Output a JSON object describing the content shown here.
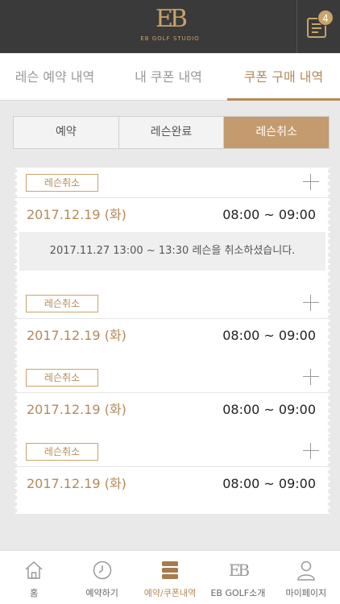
{
  "header": {
    "logo_mark": "EB",
    "logo_text": "EB GOLF STUDIO",
    "notice_count": "4"
  },
  "tabs": [
    {
      "label": "레슨 예약 내역",
      "active": false
    },
    {
      "label": "내 쿠폰 내역",
      "active": false
    },
    {
      "label": "쿠폰 구매 내역",
      "active": true
    }
  ],
  "segment": [
    {
      "label": "예약",
      "active": false
    },
    {
      "label": "레슨완료",
      "active": false
    },
    {
      "label": "레슨취소",
      "active": true
    }
  ],
  "cards": [
    {
      "badge": "레슨취소",
      "date": "2017.12.19 (화)",
      "time": "08:00 ~ 09:00",
      "note": "2017.11.27 13:00 ~ 13:30 레슨을 취소하셨습니다."
    },
    {
      "badge": "레슨취소",
      "date": "2017.12.19 (화)",
      "time": "08:00 ~ 09:00"
    },
    {
      "badge": "레슨취소",
      "date": "2017.12.19 (화)",
      "time": "08:00 ~ 09:00"
    },
    {
      "badge": "레슨취소",
      "date": "2017.12.19 (화)",
      "time": "08:00 ~ 09:00"
    }
  ],
  "bottom_nav": [
    {
      "label": "홈",
      "icon": "home-icon"
    },
    {
      "label": "예약하기",
      "icon": "clock-icon"
    },
    {
      "label": "예약/쿠폰내역",
      "icon": "stack-icon",
      "active": true
    },
    {
      "label": "EB GOLF소개",
      "icon": "eb-logo-icon"
    },
    {
      "label": "마이페이지",
      "icon": "person-icon"
    }
  ],
  "colors": {
    "accent": "#b38a5a",
    "header_bg": "#3a3a3a",
    "page_bg": "#e9e9e9"
  }
}
